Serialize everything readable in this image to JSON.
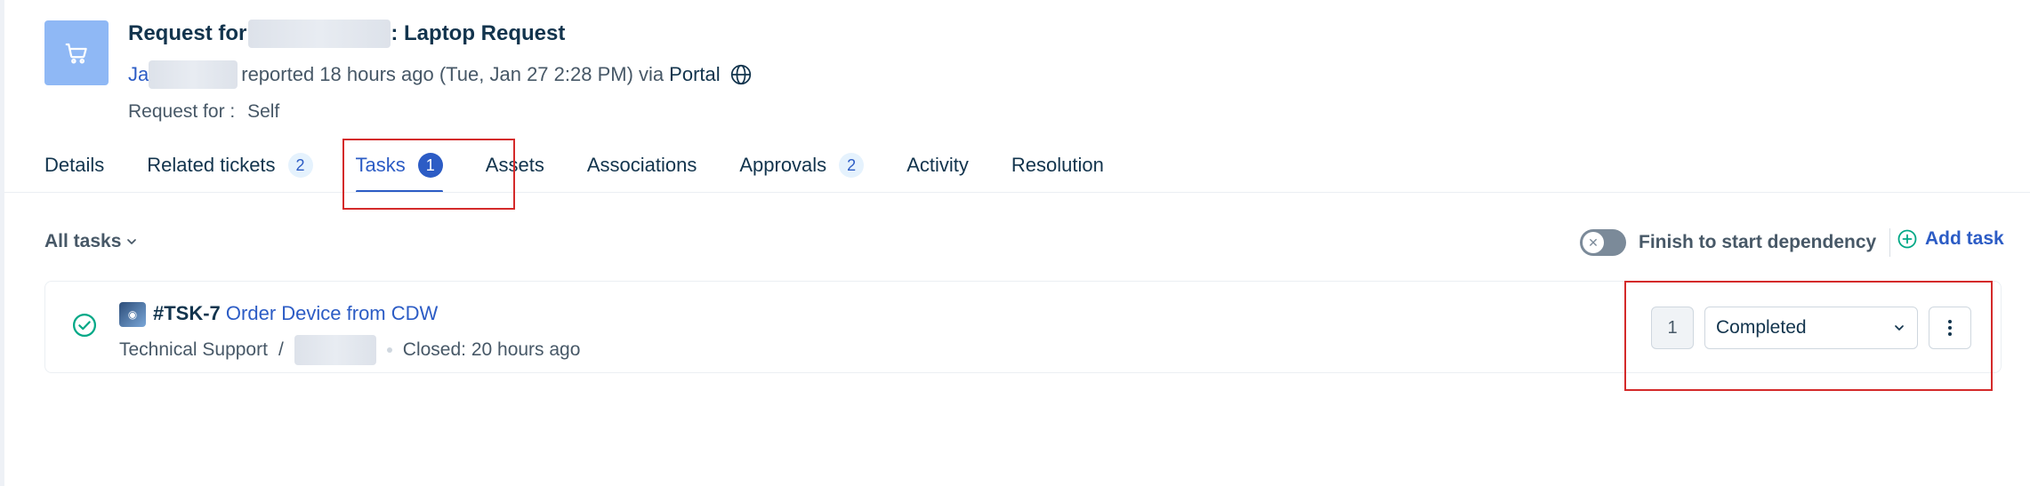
{
  "request": {
    "title_prefix": "Request for",
    "title_suffix": ": Laptop Request",
    "requester_initials": "Ja",
    "reported_text": "reported 18 hours ago (Tue, Jan 27 2:28 PM) via",
    "source": "Portal",
    "request_for_label": "Request for :",
    "request_for_value": "Self"
  },
  "tabs": [
    {
      "label": "Details",
      "count": null
    },
    {
      "label": "Related tickets",
      "count": "2"
    },
    {
      "label": "Tasks",
      "count": "1",
      "active": true
    },
    {
      "label": "Assets",
      "count": null
    },
    {
      "label": "Associations",
      "count": null
    },
    {
      "label": "Approvals",
      "count": "2"
    },
    {
      "label": "Activity",
      "count": null
    },
    {
      "label": "Resolution",
      "count": null
    }
  ],
  "toolbar": {
    "filter_label": "All tasks",
    "dependency_label": "Finish to start dependency",
    "add_task_label": "Add task"
  },
  "task": {
    "id": "#TSK-7",
    "name": "Order Device from CDW",
    "group": "Technical Support",
    "separator": "/",
    "closed_text": "Closed: 20 hours ago",
    "order_number": "1",
    "status": "Completed"
  },
  "colors": {
    "accent": "#2c5cc5",
    "success": "#00a886",
    "highlight_box": "#d42a2a",
    "icon_tile": "#8fb8f5"
  },
  "icons": {
    "request": "cart-icon",
    "source": "globe-icon",
    "task_status": "check-circle-icon",
    "add": "plus-circle-icon",
    "more": "kebab-menu-icon"
  }
}
